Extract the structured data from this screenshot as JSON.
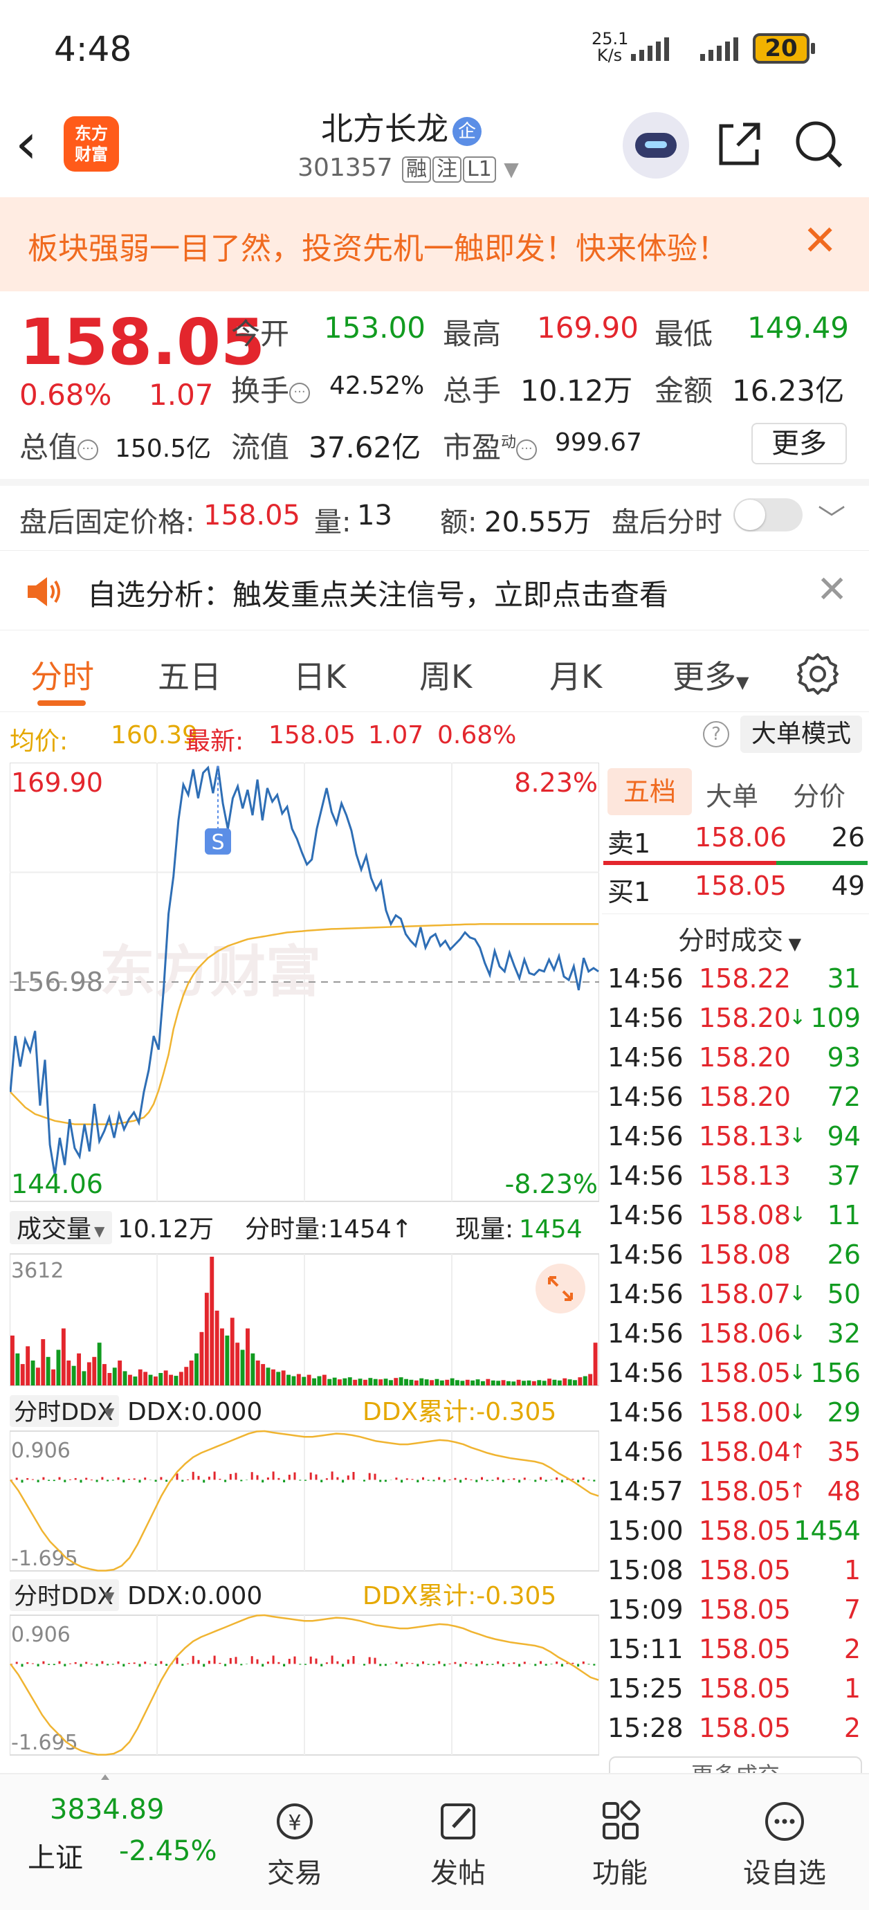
{
  "status_bar": {
    "time": "4:48",
    "net_speed_value": "25.1",
    "net_speed_unit": "K/s",
    "battery": "20"
  },
  "header": {
    "logo_line1": "东方",
    "logo_line2": "财富",
    "stock_name": "北方长龙",
    "badge": "企",
    "code": "301357",
    "tag1": "融",
    "tag2": "注",
    "tag3": "L1"
  },
  "banner": {
    "text": "板块强弱一目了然，投资先机一触即发！快来体验！"
  },
  "quote": {
    "price": "158.05",
    "change_pct": "0.68%",
    "change": "1.07",
    "open_label": "今开",
    "open": "153.00",
    "high_label": "最高",
    "high": "169.90",
    "low_label": "最低",
    "low": "149.49",
    "turnover_label": "换手",
    "turnover": "42.52%",
    "volume_label": "总手",
    "volume": "10.12万",
    "amount_label": "金额",
    "amount": "16.23亿",
    "mcap_label": "总值",
    "mcap": "150.5亿",
    "float_label": "流值",
    "float_value": "37.62亿",
    "pe_label": "市盈",
    "pe_sup": "动",
    "pe": "999.67",
    "more_label": "更多"
  },
  "after_hours": {
    "price_label": "盘后固定价格:",
    "price": "158.05",
    "vol_label": "量:",
    "vol": "13",
    "amt_label": "额:",
    "amt": "20.55万",
    "toggle_label": "盘后分时"
  },
  "alert": {
    "text": "自选分析：触发重点关注信号，立即点击查看"
  },
  "tabs": [
    "分时",
    "五日",
    "日K",
    "周K",
    "月K",
    "更多"
  ],
  "avg_line": {
    "avg_label": "均价:",
    "avg": "160.39",
    "latest_label": "最新:",
    "latest": "158.05",
    "change": "1.07",
    "pct": "0.68%",
    "mode_button": "大单模式"
  },
  "chart_data": {
    "type": "line",
    "y_top": "169.90",
    "y_mid": "156.98",
    "y_bottom": "144.06",
    "pct_top": "8.23%",
    "pct_bottom": "-8.23%",
    "marker": "S",
    "ylim": [
      144.06,
      169.9
    ],
    "prev_close": 156.98,
    "series": [
      {
        "values": [
          150.5,
          153.8,
          152.0,
          153.6,
          152.9,
          154.1,
          149.7,
          152.4,
          147.4,
          145.6,
          147.8,
          146.2,
          148.9,
          147.2,
          146.7,
          148.6,
          147.0,
          149.8,
          147.6,
          148.2,
          149.0,
          147.8,
          149.2,
          148.3,
          148.9,
          149.3,
          148.7,
          150.5,
          151.8,
          153.8,
          153.0,
          156.5,
          161.0,
          163.2,
          166.5,
          168.6,
          168.0,
          169.5,
          167.8,
          169.3,
          169.6,
          168.1,
          169.7,
          167.5,
          166.0,
          167.8,
          168.5,
          167.2,
          168.3,
          166.8,
          168.9,
          166.5,
          168.4,
          167.6,
          168.0,
          166.9,
          167.3,
          166.0,
          165.4,
          164.6,
          163.9,
          164.2,
          166.0,
          167.2,
          168.4,
          167.0,
          166.3,
          167.5,
          166.8,
          165.9,
          164.5,
          163.6,
          164.4,
          163.1,
          162.4,
          162.9,
          161.2,
          160.4,
          160.9,
          160.7,
          159.8,
          159.4,
          159.1,
          160.2,
          159.0,
          159.6,
          159.8,
          159.1,
          159.4,
          158.9,
          159.2,
          159.5,
          159.9,
          159.6,
          159.5,
          159.0,
          158.1,
          157.4,
          158.8,
          157.9,
          157.6,
          158.7,
          157.9,
          157.2,
          158.3,
          157.5,
          157.4,
          157.7,
          157.6,
          158.3,
          157.7,
          158.5,
          157.3,
          157.1,
          157.9,
          156.5,
          158.4,
          157.6,
          157.8,
          157.6
        ]
      },
      {
        "values": [
          150.5,
          150.2,
          149.9,
          149.6,
          149.4,
          149.2,
          149.1,
          149.0,
          148.9,
          148.8,
          148.75,
          148.7,
          148.65,
          148.6,
          148.6,
          148.6,
          148.6,
          148.6,
          148.6,
          148.6,
          148.6,
          148.6,
          148.65,
          148.7,
          148.75,
          148.8,
          148.9,
          149.0,
          149.3,
          149.8,
          150.6,
          151.6,
          152.7,
          154.2,
          155.3,
          156.2,
          156.9,
          157.4,
          157.8,
          158.1,
          158.4,
          158.6,
          158.8,
          158.95,
          159.1,
          159.2,
          159.3,
          159.4,
          159.5,
          159.55,
          159.6,
          159.65,
          159.7,
          159.75,
          159.8,
          159.85,
          159.9,
          159.92,
          159.95,
          159.97,
          160.0,
          160.02,
          160.04,
          160.06,
          160.08,
          160.1,
          160.11,
          160.12,
          160.13,
          160.14,
          160.15,
          160.16,
          160.17,
          160.18,
          160.19,
          160.2,
          160.21,
          160.22,
          160.23,
          160.24,
          160.25,
          160.26,
          160.27,
          160.28,
          160.29,
          160.3,
          160.31,
          160.32,
          160.33,
          160.34,
          160.35,
          160.36,
          160.37,
          160.38,
          160.38,
          160.39,
          160.39,
          160.39,
          160.39,
          160.39,
          160.39,
          160.39,
          160.39,
          160.39,
          160.39,
          160.39,
          160.39,
          160.39,
          160.39,
          160.39,
          160.39,
          160.39,
          160.39,
          160.39,
          160.39,
          160.39,
          160.39,
          160.39,
          160.39,
          160.39
        ]
      }
    ]
  },
  "volume_panel": {
    "label": "成交量",
    "total": "10.12万",
    "tick_label": "分时量:",
    "tick": "1454",
    "cur_label": "现量:",
    "cur": "1454",
    "max": "3612",
    "bars": [
      1400,
      900,
      600,
      1100,
      700,
      500,
      1300,
      800,
      450,
      1000,
      1600,
      700,
      550,
      900,
      400,
      650,
      800,
      1200,
      600,
      350,
      500,
      700,
      400,
      300,
      250,
      450,
      380,
      300,
      250,
      350,
      420,
      300,
      270,
      380,
      520,
      700,
      900,
      1500,
      2600,
      3612,
      2100,
      1600,
      1400,
      1900,
      1200,
      1000,
      1600,
      900,
      700,
      600,
      500,
      450,
      380,
      420,
      300,
      260,
      320,
      240,
      300,
      200,
      260,
      300,
      180,
      220,
      170,
      200,
      230,
      160,
      190,
      160,
      210,
      180,
      170,
      190,
      150,
      210,
      230,
      180,
      160,
      140,
      200,
      170,
      150,
      180,
      140,
      160,
      200,
      150,
      130,
      160,
      140,
      170,
      120,
      180,
      140,
      130,
      150,
      120,
      110,
      160,
      130,
      140,
      120,
      150,
      130,
      190,
      160,
      140,
      200,
      170,
      150,
      230,
      260,
      320,
      1200
    ],
    "bar_up": [
      1,
      0,
      1,
      1,
      0,
      1,
      1,
      0,
      1,
      0,
      1,
      1,
      0,
      1,
      0,
      1,
      1,
      0,
      1,
      1,
      0,
      1,
      0,
      1,
      0,
      1,
      1,
      0,
      1,
      0,
      1,
      1,
      0,
      1,
      1,
      1,
      0,
      1,
      1,
      1,
      1,
      1,
      0,
      1,
      1,
      0,
      1,
      0,
      1,
      1,
      0,
      1,
      0,
      1,
      0,
      0,
      1,
      0,
      1,
      0,
      0,
      1,
      0,
      0,
      1,
      0,
      0,
      1,
      0,
      1,
      0,
      0,
      1,
      0,
      0,
      1,
      0,
      0,
      0,
      1,
      0,
      0,
      1,
      0,
      0,
      1,
      0,
      0,
      0,
      1,
      0,
      0,
      0,
      1,
      0,
      0,
      1,
      0,
      0,
      1,
      0,
      0,
      1,
      0,
      0,
      1,
      0,
      0,
      1,
      0,
      0,
      1,
      0,
      1,
      1
    ]
  },
  "ddx_panels": [
    {
      "label": "分时DDX",
      "ddx_label": "DDX:",
      "ddx": "0.000",
      "cum_label": "DDX累计:",
      "cum": "-0.305",
      "ymax": "0.906",
      "ymin": "-1.695"
    },
    {
      "label": "分时DDX",
      "ddx_label": "DDX:",
      "ddx": "0.000",
      "cum_label": "DDX累计:",
      "cum": "-0.305",
      "ymax": "0.906",
      "ymin": "-1.695"
    }
  ],
  "ddx_curve": [
    0.0,
    -0.2,
    -0.45,
    -0.7,
    -0.95,
    -1.15,
    -1.3,
    -1.45,
    -1.55,
    -1.62,
    -1.66,
    -1.69,
    -1.69,
    -1.67,
    -1.6,
    -1.45,
    -1.2,
    -0.9,
    -0.6,
    -0.3,
    -0.05,
    0.15,
    0.3,
    0.42,
    0.5,
    0.56,
    0.62,
    0.68,
    0.74,
    0.8,
    0.86,
    0.9,
    0.906,
    0.88,
    0.86,
    0.84,
    0.82,
    0.8,
    0.8,
    0.82,
    0.84,
    0.86,
    0.85,
    0.83,
    0.8,
    0.76,
    0.72,
    0.7,
    0.68,
    0.66,
    0.66,
    0.68,
    0.7,
    0.72,
    0.74,
    0.73,
    0.7,
    0.66,
    0.6,
    0.55,
    0.5,
    0.46,
    0.43,
    0.4,
    0.38,
    0.36,
    0.34,
    0.3,
    0.22,
    0.12,
    0.04,
    -0.05,
    -0.15,
    -0.25,
    -0.3
  ],
  "order_book": {
    "tabs": [
      "五档",
      "大单",
      "分价"
    ],
    "sell_label": "卖1",
    "sell_price": "158.06",
    "sell_vol": "26",
    "buy_label": "买1",
    "buy_price": "158.05",
    "buy_vol": "49",
    "ticks_title": "分时成交",
    "more_label": "更多成交",
    "ticks": [
      {
        "time": "14:56",
        "price": "158.22",
        "arrow": "",
        "vol": "31"
      },
      {
        "time": "14:56",
        "price": "158.20",
        "arrow": "↓",
        "vol": "109"
      },
      {
        "time": "14:56",
        "price": "158.20",
        "arrow": "",
        "vol": "93"
      },
      {
        "time": "14:56",
        "price": "158.20",
        "arrow": "",
        "vol": "72"
      },
      {
        "time": "14:56",
        "price": "158.13",
        "arrow": "↓",
        "vol": "94"
      },
      {
        "time": "14:56",
        "price": "158.13",
        "arrow": "",
        "vol": "37"
      },
      {
        "time": "14:56",
        "price": "158.08",
        "arrow": "↓",
        "vol": "11"
      },
      {
        "time": "14:56",
        "price": "158.08",
        "arrow": "",
        "vol": "26"
      },
      {
        "time": "14:56",
        "price": "158.07",
        "arrow": "↓",
        "vol": "50"
      },
      {
        "time": "14:56",
        "price": "158.06",
        "arrow": "↓",
        "vol": "32"
      },
      {
        "time": "14:56",
        "price": "158.05",
        "arrow": "↓",
        "vol": "156"
      },
      {
        "time": "14:56",
        "price": "158.00",
        "arrow": "↓",
        "vol": "29"
      },
      {
        "time": "14:56",
        "price": "158.04",
        "arrow": "↑",
        "vol": "35"
      },
      {
        "time": "14:57",
        "price": "158.05",
        "arrow": "↑",
        "vol": "48"
      },
      {
        "time": "15:00",
        "price": "158.05",
        "arrow": "",
        "vol": "1454"
      },
      {
        "time": "15:08",
        "price": "158.05",
        "arrow": "",
        "vol": "1"
      },
      {
        "time": "15:09",
        "price": "158.05",
        "arrow": "",
        "vol": "7"
      },
      {
        "time": "15:11",
        "price": "158.05",
        "arrow": "",
        "vol": "2"
      },
      {
        "time": "15:25",
        "price": "158.05",
        "arrow": "",
        "vol": "1"
      },
      {
        "time": "15:28",
        "price": "158.05",
        "arrow": "",
        "vol": "2"
      }
    ]
  },
  "bottom_nav": {
    "index_value": "3834.89",
    "index_name": "上证",
    "index_change": "-2.45%",
    "items": [
      "交易",
      "发帖",
      "功能",
      "设自选"
    ]
  },
  "colors": {
    "up": "#e3262d",
    "down": "#119b20",
    "accent": "#f06a1f",
    "price_line": "#2e6eb5",
    "avg_line": "#f0b431"
  }
}
